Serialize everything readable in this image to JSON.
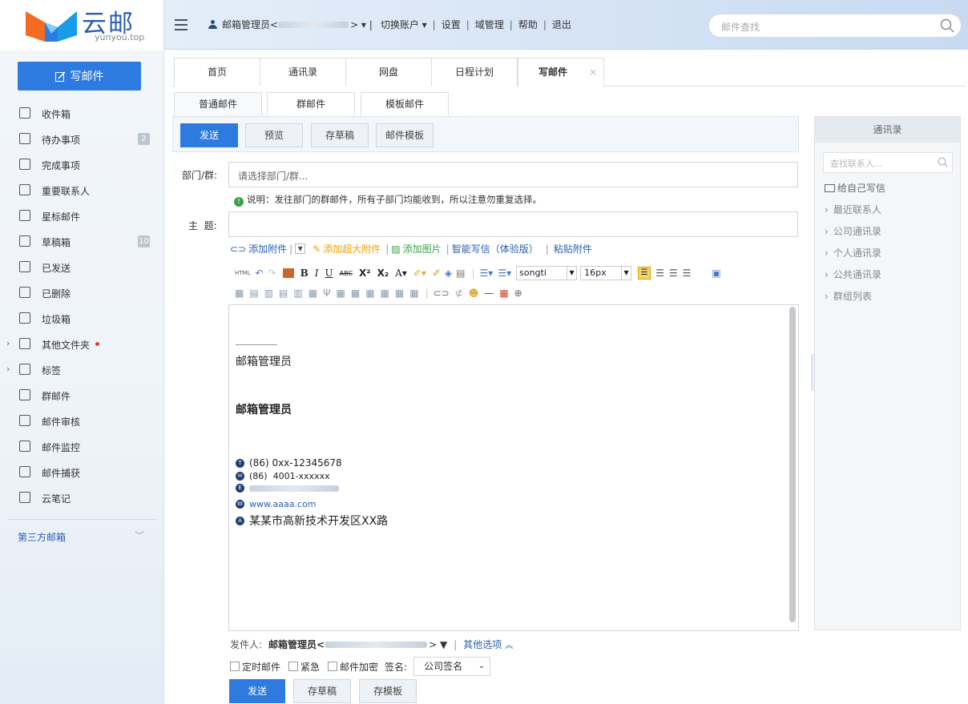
{
  "app": {
    "logo_title": "云邮",
    "logo_sub": "yunyou.top"
  },
  "topnav": {
    "user": "邮箱管理员<",
    "user_end": "> ▾ |",
    "switch_account": "切换账户 ▾",
    "settings": "设置",
    "domain_admin": "域管理",
    "help": "帮助",
    "logout": "退出",
    "search_placeholder": "邮件查找"
  },
  "sidebar": {
    "compose_label": "写邮件",
    "items": [
      {
        "label": "收件箱",
        "icon": "inbox-icon"
      },
      {
        "label": "待办事项",
        "icon": "todo-icon",
        "badge": "2"
      },
      {
        "label": "完成事项",
        "icon": "done-icon"
      },
      {
        "label": "重要联系人",
        "icon": "contact-icon"
      },
      {
        "label": "星标邮件",
        "icon": "star-icon"
      },
      {
        "label": "草稿箱",
        "icon": "draft-icon",
        "badge": "10"
      },
      {
        "label": "已发送",
        "icon": "sent-icon"
      },
      {
        "label": "已删除",
        "icon": "deleted-icon"
      },
      {
        "label": "垃圾箱",
        "icon": "trash-icon"
      },
      {
        "label": "其他文件夹",
        "icon": "folder-icon",
        "arrow": true,
        "dot": true
      },
      {
        "label": "标签",
        "icon": "tag-icon",
        "arrow": true
      },
      {
        "label": "群邮件",
        "icon": "group-icon"
      },
      {
        "label": "邮件审核",
        "icon": "audit-icon"
      },
      {
        "label": "邮件监控",
        "icon": "monitor-icon"
      },
      {
        "label": "邮件捕获",
        "icon": "capture-icon"
      },
      {
        "label": "云笔记",
        "icon": "note-icon"
      }
    ],
    "third_party": "第三方邮箱"
  },
  "tabs": [
    {
      "label": "首页"
    },
    {
      "label": "通讯录"
    },
    {
      "label": "网盘"
    },
    {
      "label": "日程计划"
    },
    {
      "label": "写邮件",
      "active": true
    }
  ],
  "subtabs": [
    "普通邮件",
    "群邮件",
    "模板邮件"
  ],
  "toolbar": {
    "send": "发送",
    "preview": "预览",
    "save_draft": "存草稿",
    "template": "邮件模板"
  },
  "form": {
    "dept_label": "部门/群:",
    "dept_placeholder": "请选择部门/群...",
    "note": "说明：发往部门的群邮件，所有子部门均能收到，所以注意勿重复选择。",
    "subject_label": "主  题:"
  },
  "attach": {
    "add_attachment": "添加附件",
    "add_large": "添加超大附件",
    "add_image": "添加图片",
    "smart_write": "智能写信（体验版）",
    "paste_attach": "粘贴附件"
  },
  "editor": {
    "font": "songti",
    "size": "16px",
    "sig_name1": "邮箱管理员",
    "sig_name2": "邮箱管理员",
    "phone1": "(86) 0xx-12345678",
    "phone2": "(86)  4001-xxxxxx",
    "website": "www.aaaa.com",
    "address": "某某市高新技术开发区XX路"
  },
  "contacts": {
    "title": "通讯录",
    "search_placeholder": "查找联系人...",
    "write_self": "给自己写信",
    "items": [
      "最近联系人",
      "公司通讯录",
      "个人通讯录",
      "公共通讯录",
      "群组列表"
    ]
  },
  "bottom": {
    "sender_label": "发件人:",
    "sender_name": "邮箱管理员<",
    "sender_end": "> ▼",
    "other_options": "其他选项",
    "scheduled": "定时邮件",
    "urgent": "紧急",
    "encrypt": "邮件加密",
    "signature_label": "签名:",
    "signature_value": "公司签名",
    "send": "发送",
    "save_draft": "存草稿",
    "save_template": "存模板"
  },
  "colors": {
    "accent": "#2d7be0",
    "link": "#2b5fb1",
    "success": "#3aa34a",
    "warn": "#f5a000"
  }
}
